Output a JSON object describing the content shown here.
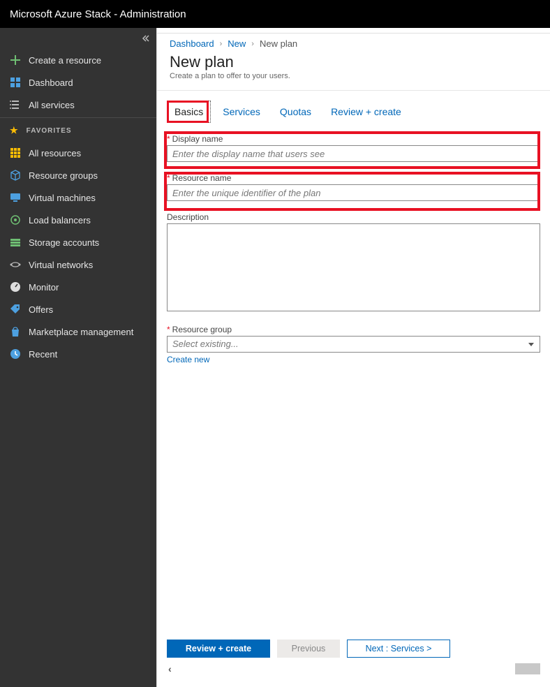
{
  "topbar": {
    "title": "Microsoft Azure Stack - Administration"
  },
  "sidebar": {
    "create_label": "Create a resource",
    "dashboard_label": "Dashboard",
    "all_services_label": "All services",
    "favorites_header": "FAVORITES",
    "favorites": [
      {
        "label": "All resources",
        "icon": "grid",
        "color": "#fbbc04"
      },
      {
        "label": "Resource groups",
        "icon": "cube",
        "color": "#4da0e0"
      },
      {
        "label": "Virtual machines",
        "icon": "vm",
        "color": "#4da0e0"
      },
      {
        "label": "Load balancers",
        "icon": "lb",
        "color": "#6fbf73"
      },
      {
        "label": "Storage accounts",
        "icon": "storage",
        "color": "#6fbf73"
      },
      {
        "label": "Virtual networks",
        "icon": "vnet",
        "color": "#bbb"
      },
      {
        "label": "Monitor",
        "icon": "gauge",
        "color": "#ddd"
      },
      {
        "label": "Offers",
        "icon": "tag",
        "color": "#4da0e0"
      },
      {
        "label": "Marketplace management",
        "icon": "bag",
        "color": "#4da0e0"
      },
      {
        "label": "Recent",
        "icon": "clock",
        "color": "#4da0e0"
      }
    ]
  },
  "breadcrumb": {
    "items": [
      {
        "label": "Dashboard",
        "link": true
      },
      {
        "label": "New",
        "link": true
      },
      {
        "label": "New plan",
        "link": false
      }
    ]
  },
  "page": {
    "title": "New plan",
    "subtitle": "Create a plan to offer to your users."
  },
  "tabs": [
    {
      "key": "basics",
      "label": "Basics",
      "active": true
    },
    {
      "key": "services",
      "label": "Services",
      "active": false
    },
    {
      "key": "quotas",
      "label": "Quotas",
      "active": false
    },
    {
      "key": "review",
      "label": "Review + create",
      "active": false
    }
  ],
  "form": {
    "display_name": {
      "label": "Display name",
      "placeholder": "Enter the display name that users see",
      "required": true
    },
    "resource_name": {
      "label": "Resource name",
      "placeholder": "Enter the unique identifier of the plan",
      "required": true
    },
    "description": {
      "label": "Description"
    },
    "resource_group": {
      "label": "Resource group",
      "placeholder": "Select existing...",
      "required": true,
      "create_new": "Create new"
    }
  },
  "footer": {
    "review_create": "Review + create",
    "previous": "Previous",
    "next": "Next : Services >"
  }
}
